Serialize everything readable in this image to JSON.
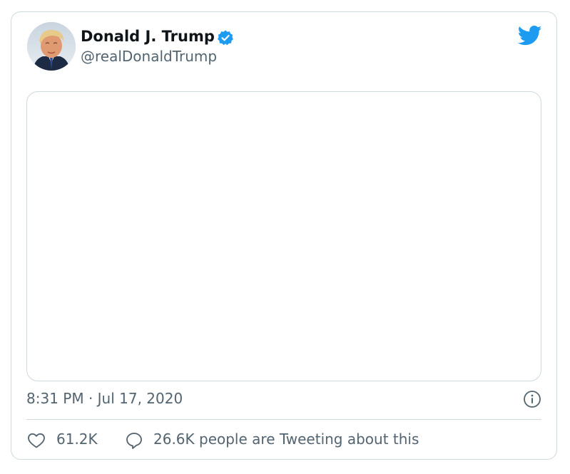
{
  "author": {
    "name": "Donald J. Trump",
    "handle": "@realDonaldTrump",
    "verified_icon": "verified-badge-icon",
    "avatar": "profile-photo"
  },
  "brand": {
    "icon": "twitter-bird-icon",
    "accent_color": "#1d9bf0"
  },
  "media": {
    "state": "empty"
  },
  "meta": {
    "timestamp": "8:31 PM · Jul 17, 2020",
    "info_icon": "info-icon"
  },
  "actions": {
    "like_icon": "heart-icon",
    "likes": "61.2K",
    "reply_icon": "reply-bubble-icon",
    "tweeting": "26.6K people are Tweeting about this"
  },
  "colors": {
    "text_primary": "#0f1419",
    "text_secondary": "#536471",
    "border": "#cfd9de"
  }
}
